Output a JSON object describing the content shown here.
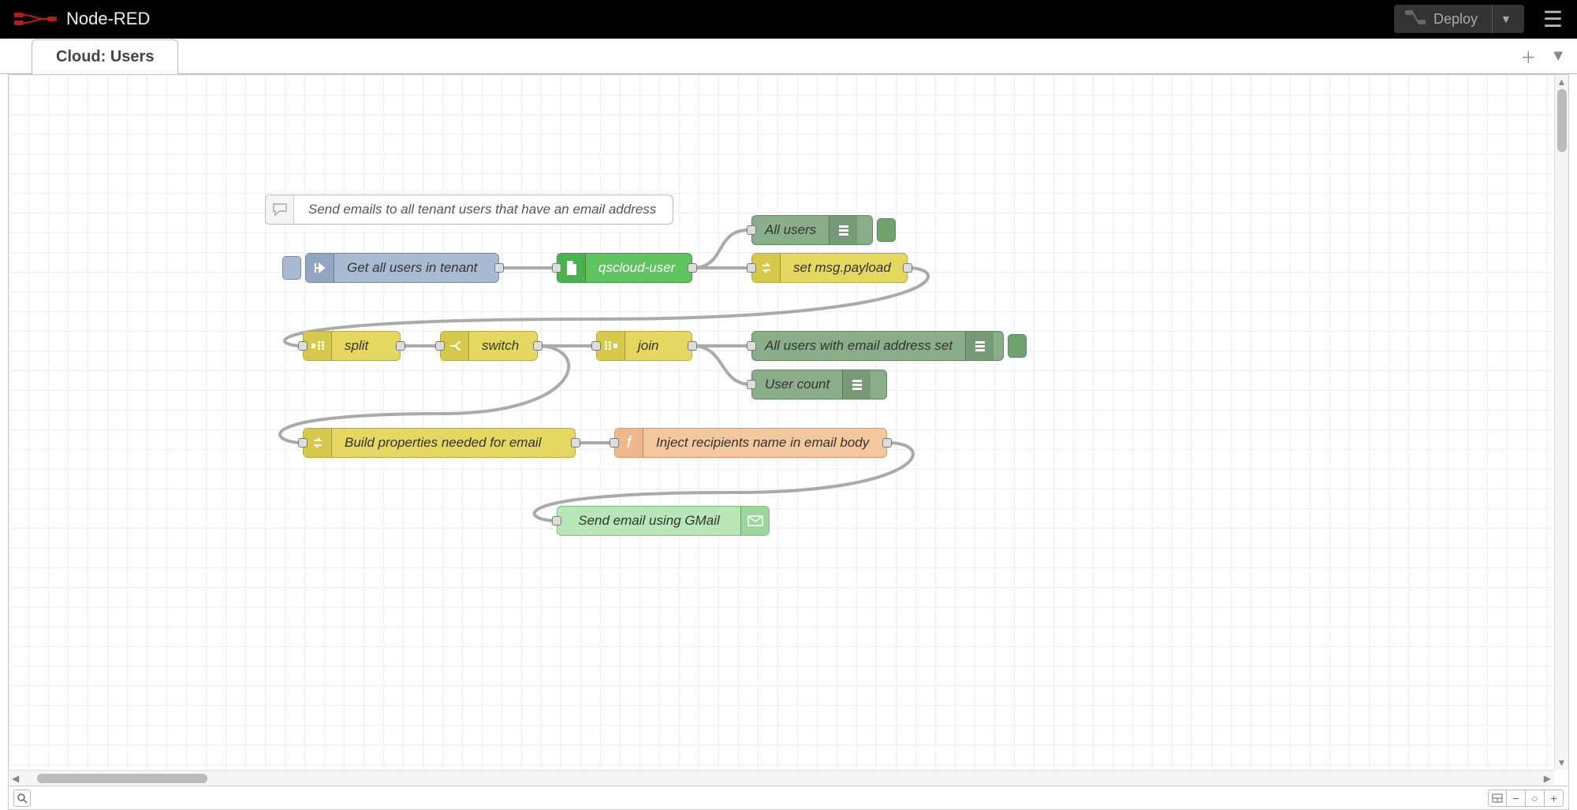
{
  "header": {
    "title": "Node-RED",
    "deploy_label": "Deploy"
  },
  "tabs": {
    "active": "Cloud: Users"
  },
  "nodes": {
    "comment": "Send emails to all tenant users that have an email address",
    "inject": "Get all users in tenant",
    "qscloud": "qscloud-user",
    "setpayload": "set msg.payload",
    "allusers": "All users",
    "split": "split",
    "switch": "switch",
    "join": "join",
    "allemail": "All users with email address set",
    "usercount": "User count",
    "buildprops": "Build properties needed for email",
    "injectname": "Inject recipients name in email body",
    "sendemail": "Send email using GMail"
  }
}
